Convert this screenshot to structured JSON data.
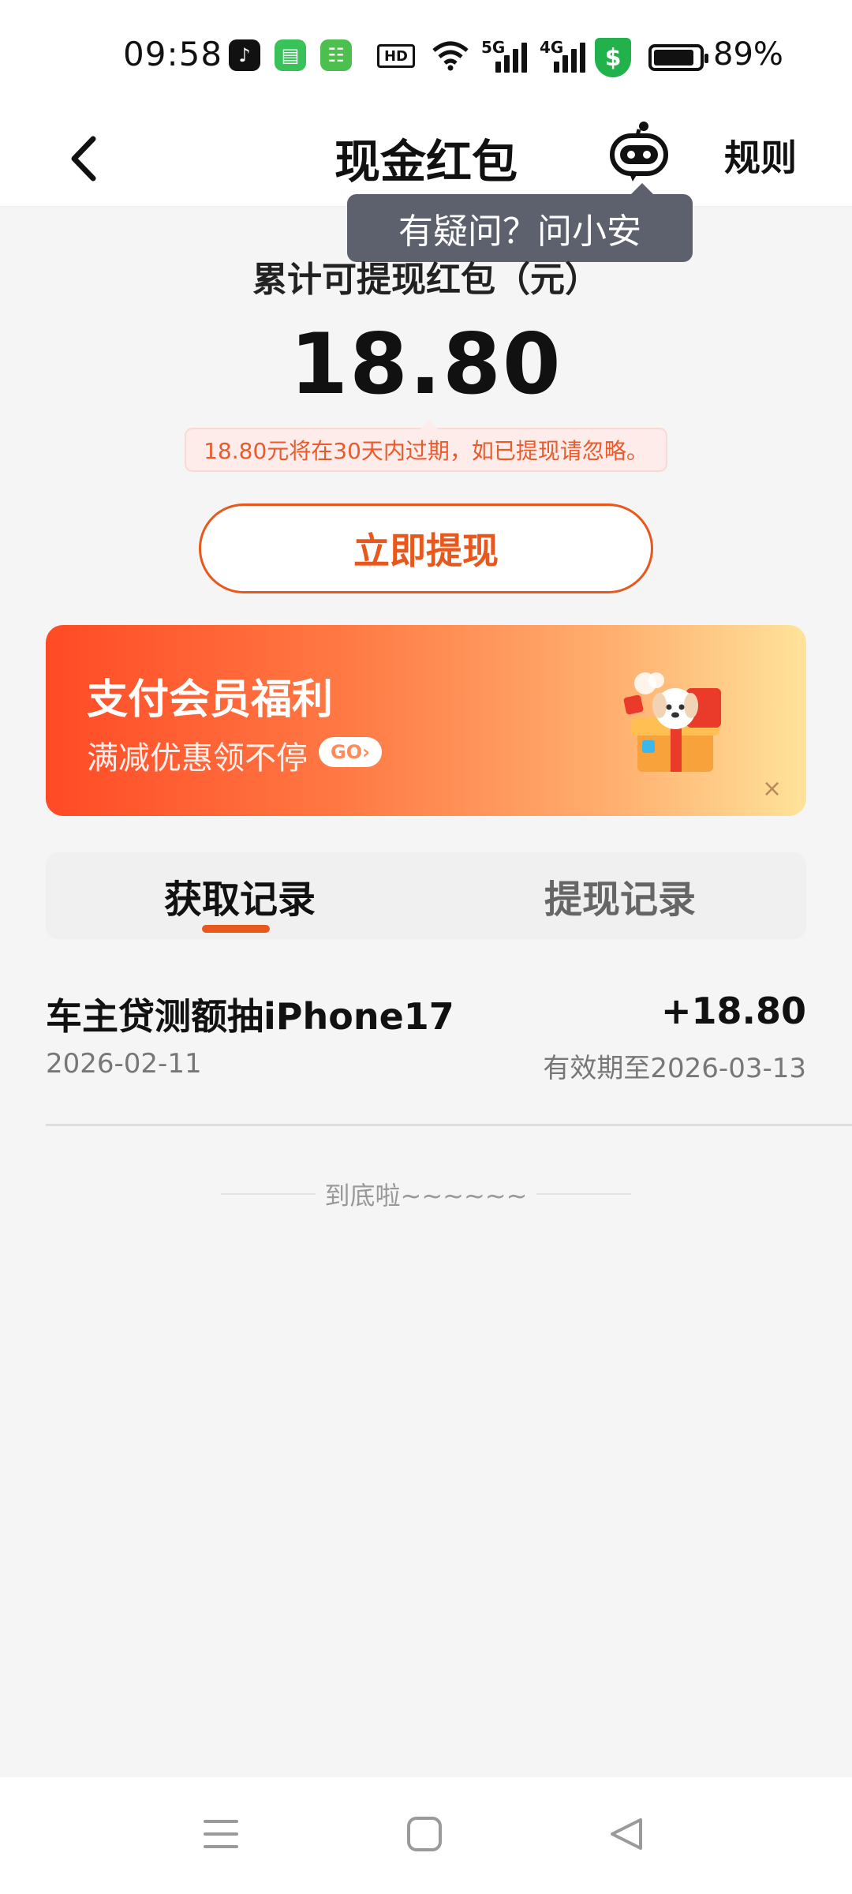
{
  "status_bar": {
    "time": "09:58",
    "hd_label": "HD",
    "net1": "5G",
    "net2": "4G",
    "battery_text": "89%",
    "battery_level": 0.89,
    "shield_symbol": "$"
  },
  "nav": {
    "title": "现金红包",
    "rules_label": "规则"
  },
  "tooltip": "有疑问？问小安",
  "balance": {
    "label": "累计可提现红包（元）",
    "amount": "18.80",
    "expire_note": "18.80元将在30天内过期，如已提现请忽略。"
  },
  "withdraw_button": "立即提现",
  "banner": {
    "title": "支付会员福利",
    "subtitle": "满减优惠领不停",
    "go_label": "GO›",
    "close": "×"
  },
  "tabs": [
    {
      "label": "获取记录",
      "active": true
    },
    {
      "label": "提现记录",
      "active": false
    }
  ],
  "records": [
    {
      "title": "车主贷测额抽iPhone17",
      "date": "2026-02-11",
      "amount": "+18.80",
      "expiry": "有效期至2026-03-13"
    }
  ],
  "end_text": "到底啦~~~~~~",
  "colors": {
    "accent": "#e8581c",
    "tooltip_bg": "#5d616e",
    "note_bg": "#fdecea",
    "shield": "#22b24c"
  },
  "icons": {
    "back": "chevron-left-icon",
    "assistant": "robot-icon",
    "gift": "gift-box-icon",
    "sysnav": [
      "menu-icon",
      "home-square-icon",
      "back-triangle-icon"
    ]
  }
}
